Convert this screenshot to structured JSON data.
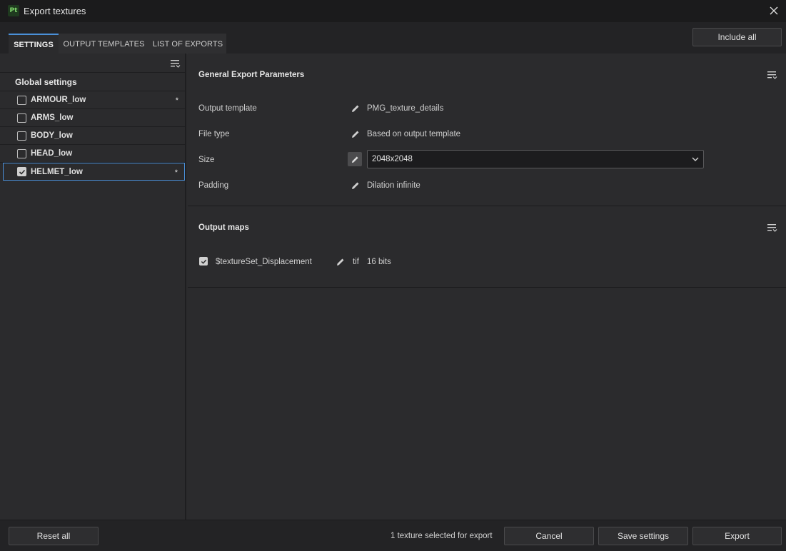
{
  "window": {
    "title": "Export textures",
    "app_icon_text": "Pt"
  },
  "tabs": [
    {
      "label": "SETTINGS",
      "active": true
    },
    {
      "label": "OUTPUT TEMPLATES",
      "active": false
    },
    {
      "label": "LIST OF EXPORTS",
      "active": false
    }
  ],
  "toolbar": {
    "include_all_label": "Include all"
  },
  "sidebar": {
    "global_label": "Global settings",
    "texture_sets": [
      {
        "label": "ARMOUR_low",
        "checked": false,
        "modified": "*"
      },
      {
        "label": "ARMS_low",
        "checked": false,
        "modified": ""
      },
      {
        "label": "BODY_low",
        "checked": false,
        "modified": ""
      },
      {
        "label": "HEAD_low",
        "checked": false,
        "modified": ""
      },
      {
        "label": "HELMET_low",
        "checked": true,
        "modified": "*"
      }
    ]
  },
  "general": {
    "title": "General Export Parameters",
    "output_template_label": "Output template",
    "output_template_value": "PMG_texture_details",
    "file_type_label": "File type",
    "file_type_value": "Based on output template",
    "size_label": "Size",
    "size_value": "2048x2048",
    "padding_label": "Padding",
    "padding_value": "Dilation infinite"
  },
  "output_maps": {
    "title": "Output maps",
    "maps": [
      {
        "name": "$textureSet_Displacement",
        "format": "tif",
        "bits": "16 bits",
        "checked": true
      }
    ]
  },
  "footer": {
    "reset_label": "Reset all",
    "status_text": "1 texture selected for export",
    "cancel_label": "Cancel",
    "save_label": "Save settings",
    "export_label": "Export"
  },
  "colors": {
    "accent": "#4a90d9",
    "background": "#2b2b2d",
    "titlebar": "#1b1b1c"
  }
}
